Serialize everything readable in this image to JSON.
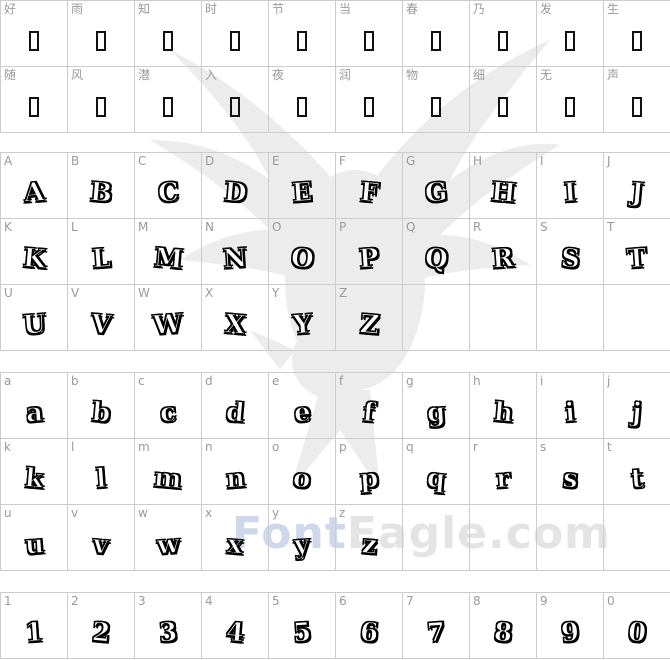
{
  "watermark": {
    "brand_part1": "Font",
    "brand_part2": "Eagle.com"
  },
  "sections": {
    "cjk": {
      "rows": [
        [
          "好",
          "雨",
          "知",
          "时",
          "节",
          "当",
          "春",
          "乃",
          "发",
          "生"
        ],
        [
          "随",
          "风",
          "潜",
          "入",
          "夜",
          "润",
          "物",
          "细",
          "无",
          "声"
        ]
      ]
    },
    "uppercase": {
      "rows": [
        [
          "A",
          "B",
          "C",
          "D",
          "E",
          "F",
          "G",
          "H",
          "I",
          "J"
        ],
        [
          "K",
          "L",
          "M",
          "N",
          "O",
          "P",
          "Q",
          "R",
          "S",
          "T"
        ],
        [
          "U",
          "V",
          "W",
          "X",
          "Y",
          "Z",
          "",
          "",
          "",
          ""
        ]
      ]
    },
    "lowercase": {
      "rows": [
        [
          "a",
          "b",
          "c",
          "d",
          "e",
          "f",
          "g",
          "h",
          "i",
          "j"
        ],
        [
          "k",
          "l",
          "m",
          "n",
          "o",
          "p",
          "q",
          "r",
          "s",
          "t"
        ],
        [
          "u",
          "v",
          "w",
          "x",
          "y",
          "z",
          "",
          "",
          "",
          ""
        ]
      ]
    },
    "digits": {
      "rows": [
        [
          "1",
          "2",
          "3",
          "4",
          "5",
          "6",
          "7",
          "8",
          "9",
          "0"
        ]
      ]
    }
  }
}
